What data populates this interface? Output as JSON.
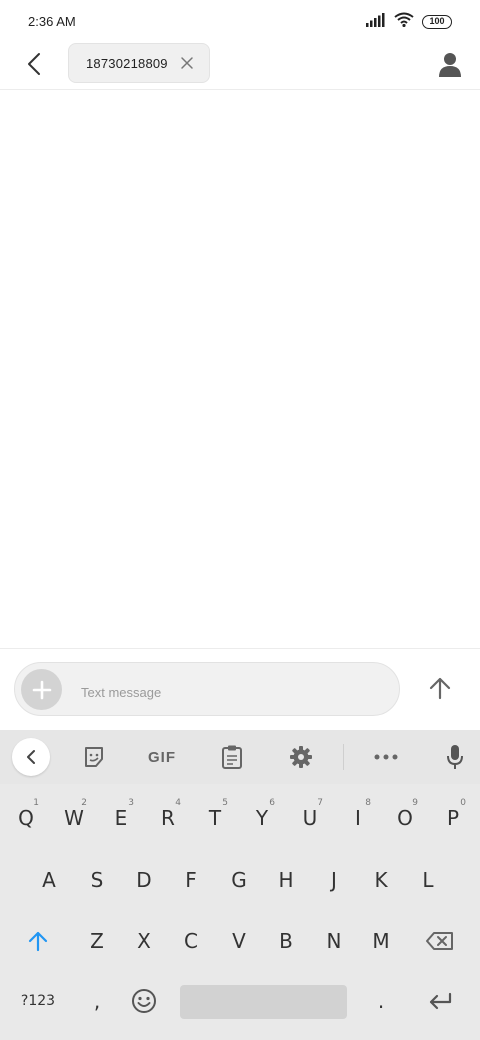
{
  "status_bar": {
    "time": "2:36 AM",
    "battery": "100"
  },
  "header": {
    "recipient": "18730218809"
  },
  "compose": {
    "placeholder": "Text message"
  },
  "keyboard": {
    "gif_label": "GIF",
    "row1": [
      {
        "key": "Q",
        "hint": "1"
      },
      {
        "key": "W",
        "hint": "2"
      },
      {
        "key": "E",
        "hint": "3"
      },
      {
        "key": "R",
        "hint": "4"
      },
      {
        "key": "T",
        "hint": "5"
      },
      {
        "key": "Y",
        "hint": "6"
      },
      {
        "key": "U",
        "hint": "7"
      },
      {
        "key": "I",
        "hint": "8"
      },
      {
        "key": "O",
        "hint": "9"
      },
      {
        "key": "P",
        "hint": "0"
      }
    ],
    "row2": [
      "A",
      "S",
      "D",
      "F",
      "G",
      "H",
      "J",
      "K",
      "L"
    ],
    "row3": [
      "Z",
      "X",
      "C",
      "V",
      "B",
      "N",
      "M"
    ],
    "symbols_label": "?123",
    "comma_label": ",",
    "period_label": "."
  },
  "colors": {
    "accent": "#2196f3",
    "keyboard_bg": "#e9e9e9",
    "attach_bg": "#d3d3d3"
  }
}
